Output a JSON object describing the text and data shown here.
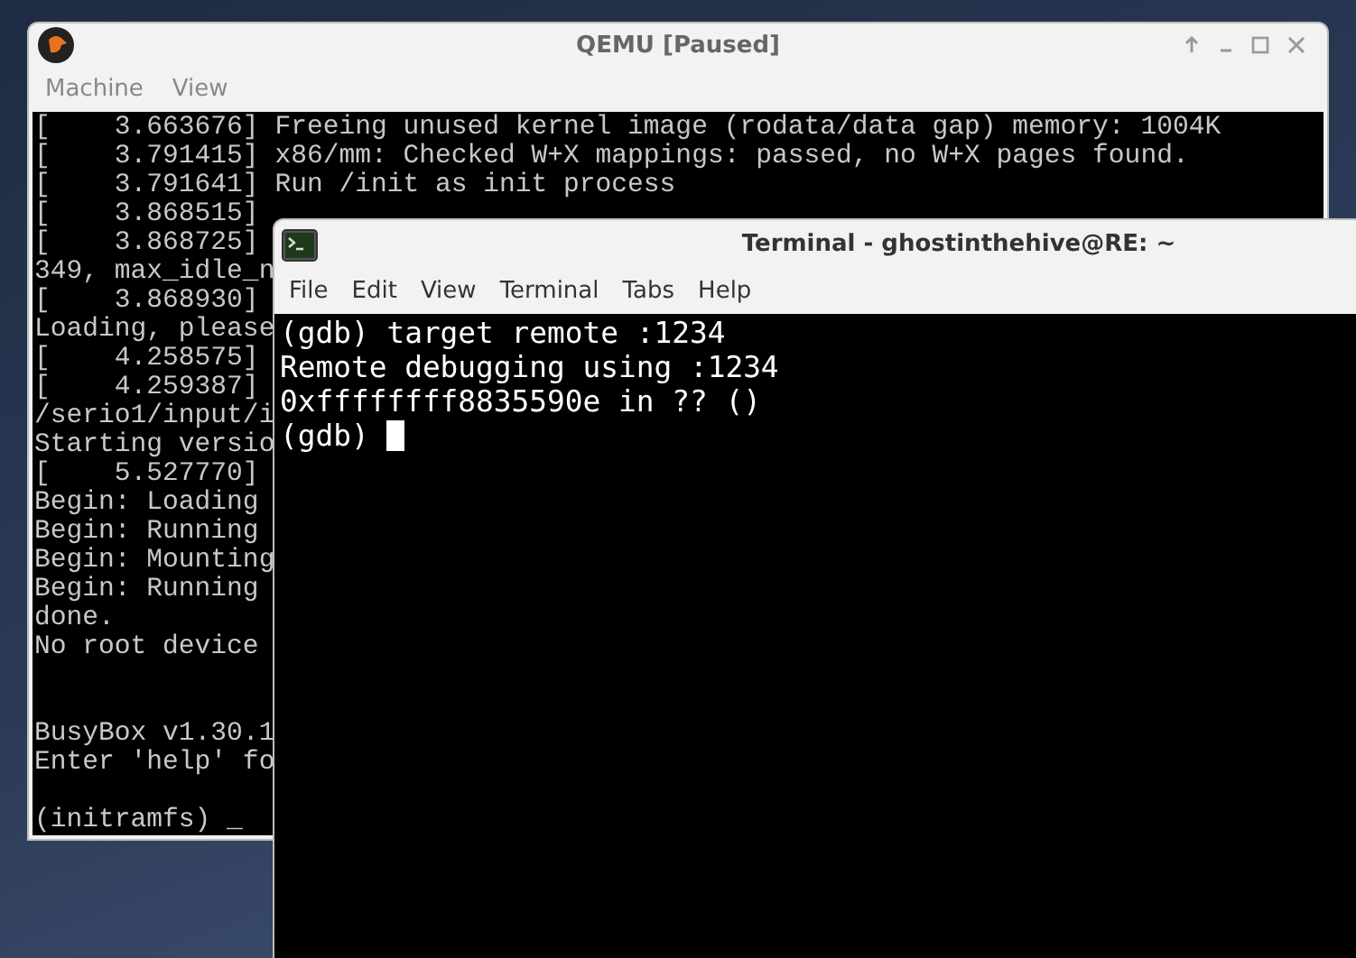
{
  "qemu_window": {
    "title": "QEMU [Paused]",
    "menu": [
      "Machine",
      "View"
    ],
    "console_lines": [
      {
        "kind": "text",
        "text": "[    3.663676] Freeing unused kernel image (rodata/data gap) memory: 1004K"
      },
      {
        "kind": "text",
        "text": "[    3.791415] x86/mm: Checked W+X mappings: passed, no W+X pages found."
      },
      {
        "kind": "text",
        "text": "[    3.791641] Run /init as init process"
      },
      {
        "kind": "text",
        "text": "[    3.868515]"
      },
      {
        "kind": "text",
        "text": "[    3.868725]"
      },
      {
        "kind": "text",
        "text": "349, max_idle_n"
      },
      {
        "kind": "text",
        "text": "[    3.868930]"
      },
      {
        "kind": "text",
        "text": "Loading, please"
      },
      {
        "kind": "text",
        "text": "[    4.258575]"
      },
      {
        "kind": "text",
        "text": "[    4.259387]"
      },
      {
        "kind": "text",
        "text": "/serio1/input/i"
      },
      {
        "kind": "text",
        "text": "Starting versio"
      },
      {
        "kind": "text",
        "text": "[    5.527770]"
      },
      {
        "kind": "text",
        "text": "Begin: Loading"
      },
      {
        "kind": "text",
        "text": "Begin: Running"
      },
      {
        "kind": "text",
        "text": "Begin: Mounting"
      },
      {
        "kind": "text",
        "text": "Begin: Running"
      },
      {
        "kind": "text",
        "text": "done."
      },
      {
        "kind": "text",
        "text": "No root device"
      },
      {
        "kind": "blank"
      },
      {
        "kind": "blank"
      },
      {
        "kind": "text",
        "text": "BusyBox v1.30.1"
      },
      {
        "kind": "text",
        "text": "Enter 'help' fo"
      },
      {
        "kind": "blank"
      },
      {
        "kind": "text",
        "text": "(initramfs) _"
      }
    ]
  },
  "terminal_window": {
    "title": "Terminal - ghostinthehive@RE: ~",
    "menu": [
      "File",
      "Edit",
      "View",
      "Terminal",
      "Tabs",
      "Help"
    ],
    "lines": [
      "(gdb) target remote :1234",
      "Remote debugging using :1234",
      "0xffffffff8835590e in ?? ()",
      "(gdb)"
    ],
    "cursor_visible": true
  }
}
